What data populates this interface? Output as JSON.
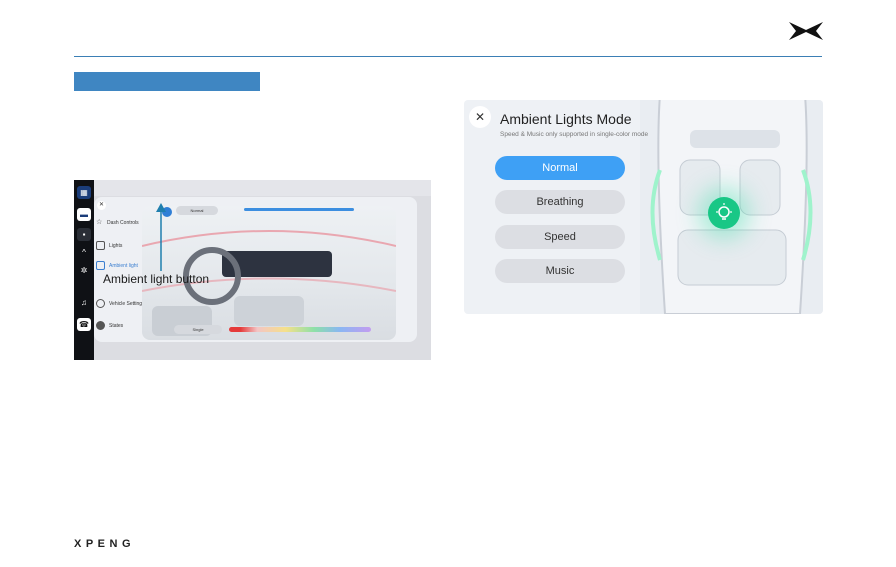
{
  "brand": {
    "footer_wordmark": "XPENG"
  },
  "left_screenshot": {
    "menu_items": [
      {
        "label": "Dash Controls",
        "icon": "star-icon"
      },
      {
        "label": "Lights",
        "icon": "headlight-icon"
      },
      {
        "label": "Ambient light",
        "icon": "ambient-light-icon"
      },
      {
        "label": "Vehicle Settings",
        "icon": "gear-icon"
      },
      {
        "label": "States",
        "icon": "target-icon"
      }
    ],
    "mode_select": "Normal",
    "single_button": "Single",
    "callout": "Ambient light button"
  },
  "ambient_panel": {
    "title": "Ambient Lights Mode",
    "subtitle": "Speed & Music only supported in single-color mode",
    "modes": [
      "Normal",
      "Breathing",
      "Speed",
      "Music"
    ],
    "selected_mode": "Normal",
    "accent_color": "#3ea0f5",
    "light_button_color": "#19c786"
  }
}
